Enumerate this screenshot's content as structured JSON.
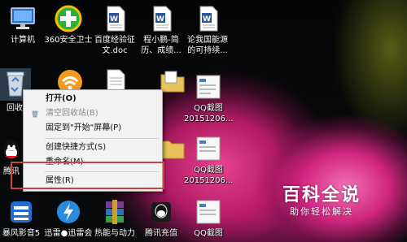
{
  "desktop_icons": [
    {
      "label": "计算机",
      "icon": "computer-icon"
    },
    {
      "label": "360安全卫士",
      "icon": "360-security-icon"
    },
    {
      "label": "百度经验征文.doc",
      "line1": "百度经验征",
      "line2": "文.doc",
      "icon": "word-doc-icon"
    },
    {
      "label": "程小鹏-简历、成绩...",
      "line1": "程小鹏-简",
      "line2": "历、成绩...",
      "icon": "word-doc-icon"
    },
    {
      "label": "论我国能源的可持续...",
      "line1": "论我国能源",
      "line2": "的可持续...",
      "icon": "word-doc-icon"
    },
    {
      "label": "回收站",
      "icon": "recycle-bin-icon"
    },
    {
      "label": "腾讯QQ",
      "icon": "qq-icon"
    },
    {
      "label": "暴风影音5",
      "icon": "baofeng-icon"
    },
    {
      "label": "迅雷●迅雷会",
      "icon": "xunlei-icon"
    },
    {
      "label": "热能与动力",
      "icon": "winrar-icon"
    },
    {
      "label": "腾讯充值",
      "icon": "tencent-recharge-icon"
    },
    {
      "label": "QQ截图",
      "icon": "qq-screenshot-icon"
    }
  ],
  "labels_partial": {
    "recycle": "回收",
    "qq": "腾讯",
    "qq_screenshot_1": "QQ截图",
    "qq_screenshot_1b": "20151206...",
    "qq_screenshot_2": "QQ截图",
    "qq_screenshot_2b": "20151206...",
    "qq_screenshot_3": "QQ截图"
  },
  "context_menu": {
    "items": [
      {
        "label": "打开(O)",
        "enabled": true
      },
      {
        "label": "清空回收站(B)",
        "enabled": false
      },
      {
        "label": "固定到\"开始\"屏幕(P)",
        "enabled": true
      },
      {
        "label": "创建快捷方式(S)",
        "enabled": true
      },
      {
        "label": "重命名(M)",
        "enabled": true
      },
      {
        "label": "属性(R)",
        "enabled": true
      }
    ],
    "highlighted": "属性(R)"
  },
  "watermark": {
    "title": "百科全说",
    "subtitle": "助你轻松解决"
  },
  "colors": {
    "highlight_border": "#c8443f",
    "menu_bg": "#f2f2f2",
    "wallpaper_pink": "#e6288c"
  }
}
